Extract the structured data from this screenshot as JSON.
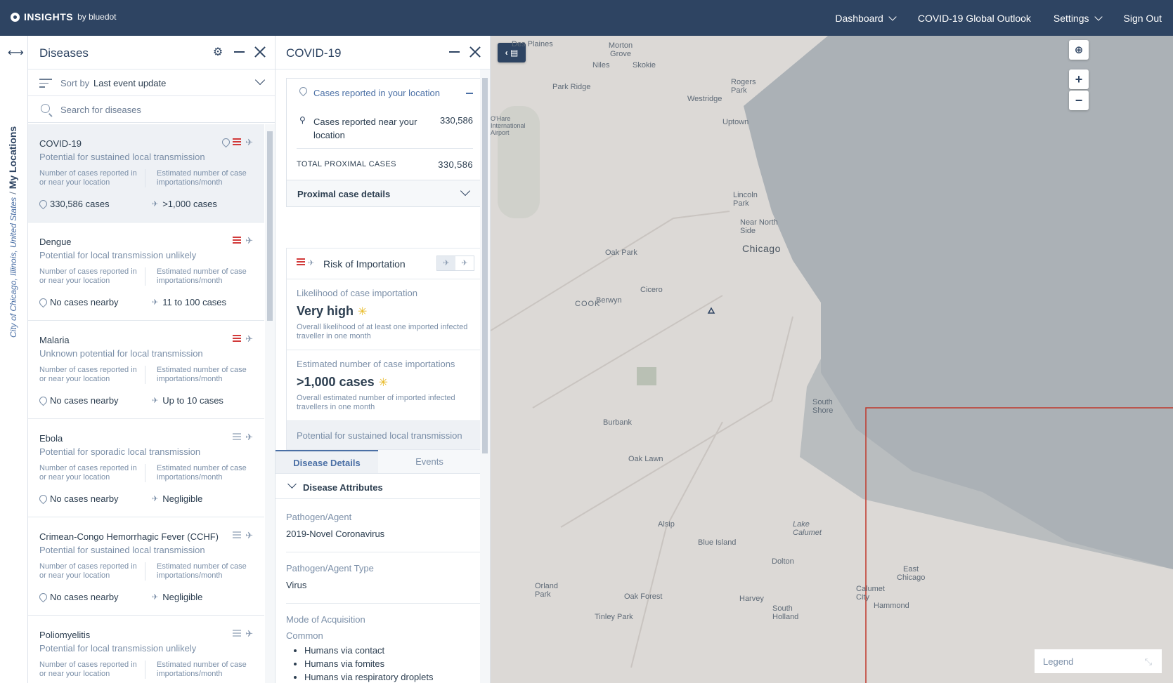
{
  "brand": {
    "name": "INSIGHTS",
    "by": "by bluedot"
  },
  "nav": {
    "dashboard": "Dashboard",
    "outlook": "COVID-19 Global Outlook",
    "settings": "Settings",
    "signout": "Sign Out"
  },
  "sidebar": {
    "location": "City of Chicago, Illinois, United States",
    "separator": "/",
    "label": "My Locations"
  },
  "diseases": {
    "title": "Diseases",
    "sort_label": "Sort by",
    "sort_value": "Last event update",
    "search_placeholder": "Search for diseases",
    "col_left": "Number of cases reported in or near your location",
    "col_right": "Estimated number of case importations/month",
    "items": [
      {
        "name": "COVID-19",
        "transmission": "Potential for sustained local transmission",
        "local": "330,586 cases",
        "import": ">1,000 cases",
        "risk_color": "#d23a3a"
      },
      {
        "name": "Dengue",
        "transmission": "Potential for local transmission unlikely",
        "local": "No cases nearby",
        "import": "11 to 100 cases",
        "risk_color": "#d23a3a"
      },
      {
        "name": "Malaria",
        "transmission": "Unknown potential for local transmission",
        "local": "No cases nearby",
        "import": "Up to 10 cases",
        "risk_color": "#d23a3a"
      },
      {
        "name": "Ebola",
        "transmission": "Potential for sporadic local transmission",
        "local": "No cases nearby",
        "import": "Negligible",
        "risk_color": "#b7c2cf"
      },
      {
        "name": "Crimean-Congo Hemorrhagic Fever (CCHF)",
        "transmission": "Potential for sustained local transmission",
        "local": "No cases nearby",
        "import": "Negligible",
        "risk_color": "#b7c2cf"
      },
      {
        "name": "Poliomyelitis",
        "transmission": "Potential for local transmission unlikely",
        "local": "",
        "import": "",
        "risk_color": "#b7c2cf"
      }
    ]
  },
  "covid": {
    "title": "COVID-19",
    "cases_in_location": "Cases reported in your location",
    "cases_near_label": "Cases reported near your location",
    "cases_near_value": "330,586",
    "total_label": "TOTAL PROXIMAL CASES",
    "total_value": "330,586",
    "proximal_details": "Proximal case details",
    "risk_title": "Risk of Importation",
    "likelihood_label": "Likelihood of case importation",
    "likelihood_value": "Very high",
    "likelihood_desc": "Overall likelihood of at least one imported infected traveller in one month",
    "estimate_label": "Estimated number of case importations",
    "estimate_value": ">1,000 cases",
    "estimate_desc": "Overall estimated number of imported infected travellers in one month",
    "transmission": "Potential for sustained local transmission",
    "tab_details": "Disease Details",
    "tab_events": "Events",
    "attributes": "Disease Attributes",
    "pathogen_label": "Pathogen/Agent",
    "pathogen_value": "2019-Novel Coronavirus",
    "type_label": "Pathogen/Agent Type",
    "type_value": "Virus",
    "mode_label": "Mode of Acquisition",
    "mode_common": "Common",
    "modes": [
      "Humans via contact",
      "Humans via fomites",
      "Humans via respiratory droplets"
    ]
  },
  "map": {
    "labels": [
      "Des Plaines",
      "Morton Grove",
      "Niles",
      "Skokie",
      "Rogers Park",
      "Park Ridge",
      "Westridge",
      "Uptown",
      "O'Hare International Airport",
      "Lincoln Park",
      "Near North Side",
      "Chicago",
      "Oak Park",
      "Cicero",
      "Berwyn",
      "COOK",
      "South Shore",
      "Burbank",
      "Oak Lawn",
      "Alsip",
      "Blue Island",
      "Lake Calumet",
      "Dolton",
      "Orland Park",
      "Oak Forest",
      "Harvey",
      "South Holland",
      "Tinley Park",
      "East Chicago",
      "Calumet City",
      "Hammond"
    ],
    "legend": "Legend",
    "zoom_in": "+",
    "zoom_out": "−"
  }
}
